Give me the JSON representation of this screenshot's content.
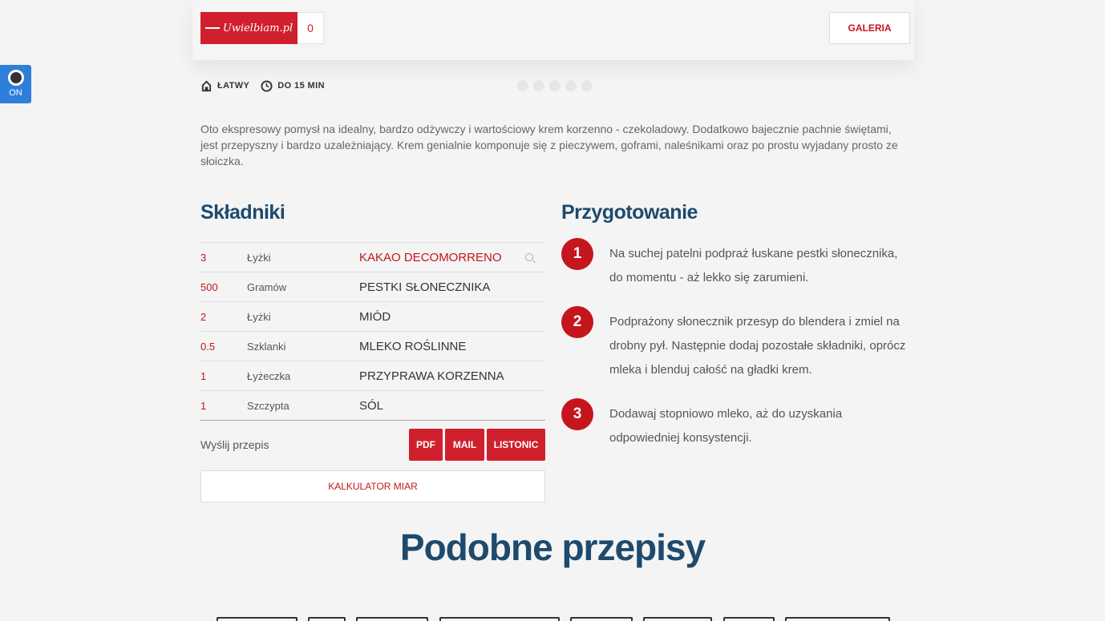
{
  "toggle": {
    "label": "ON"
  },
  "header": {
    "logo_text": "Uwielbiam.pl",
    "likes_count": "0",
    "gallery_label": "GALERIA"
  },
  "meta": {
    "difficulty": "ŁATWY",
    "time": "DO 15 MIN"
  },
  "intro": "Oto ekspresowy pomysł na idealny, bardzo odżywczy i wartościowy krem korzenno - czekoladowy. Dodatkowo bajecznie pachnie świętami, jest przepyszny i bardzo uzależniający. Krem genialnie komponuje się z pieczywem, goframi, naleśnikami oraz po prostu wyjadany prosto ze słoiczka.",
  "ingredients": {
    "title": "Składniki",
    "items": [
      {
        "qty": "3",
        "unit": "Łyżki",
        "name": "KAKAO DECOMORRENO"
      },
      {
        "qty": "500",
        "unit": "Gramów",
        "name": "PESTKI SŁONECZNIKA"
      },
      {
        "qty": "2",
        "unit": "Łyżki",
        "name": "MIÓD"
      },
      {
        "qty": "0.5",
        "unit": "Szklanki",
        "name": "MLEKO ROŚLINNE"
      },
      {
        "qty": "1",
        "unit": "Łyżeczka",
        "name": "PRZYPRAWA KORZENNA"
      },
      {
        "qty": "1",
        "unit": "Szczypta",
        "name": "SÓL"
      }
    ],
    "send_label": "Wyślij przepis",
    "pdf_label": "PDF",
    "mail_label": "MAIL",
    "listonic_label": "LISTONIC",
    "calculator_label": "KALKULATOR MIAR"
  },
  "preparation": {
    "title": "Przygotowanie",
    "steps": [
      {
        "num": "1",
        "text": "Na suchej patelni podpraż łuskane pestki słonecznika, do momentu - aż lekko się zarumieni."
      },
      {
        "num": "2",
        "text": "Podprażony słonecznik przesyp do blendera i zmiel na drobny pył. Następnie dodaj pozostałe składniki, oprócz mleka i blenduj całość na gładki krem."
      },
      {
        "num": "3",
        "text": "Dodawaj stopniowo mleko, aż do uzyskania odpowiedniej konsystencji."
      }
    ]
  },
  "similar": {
    "title": "Podobne przepisy"
  },
  "colors": {
    "accent": "#c4161c",
    "heading": "#1e4a6d",
    "toggle": "#2e7fd9"
  }
}
